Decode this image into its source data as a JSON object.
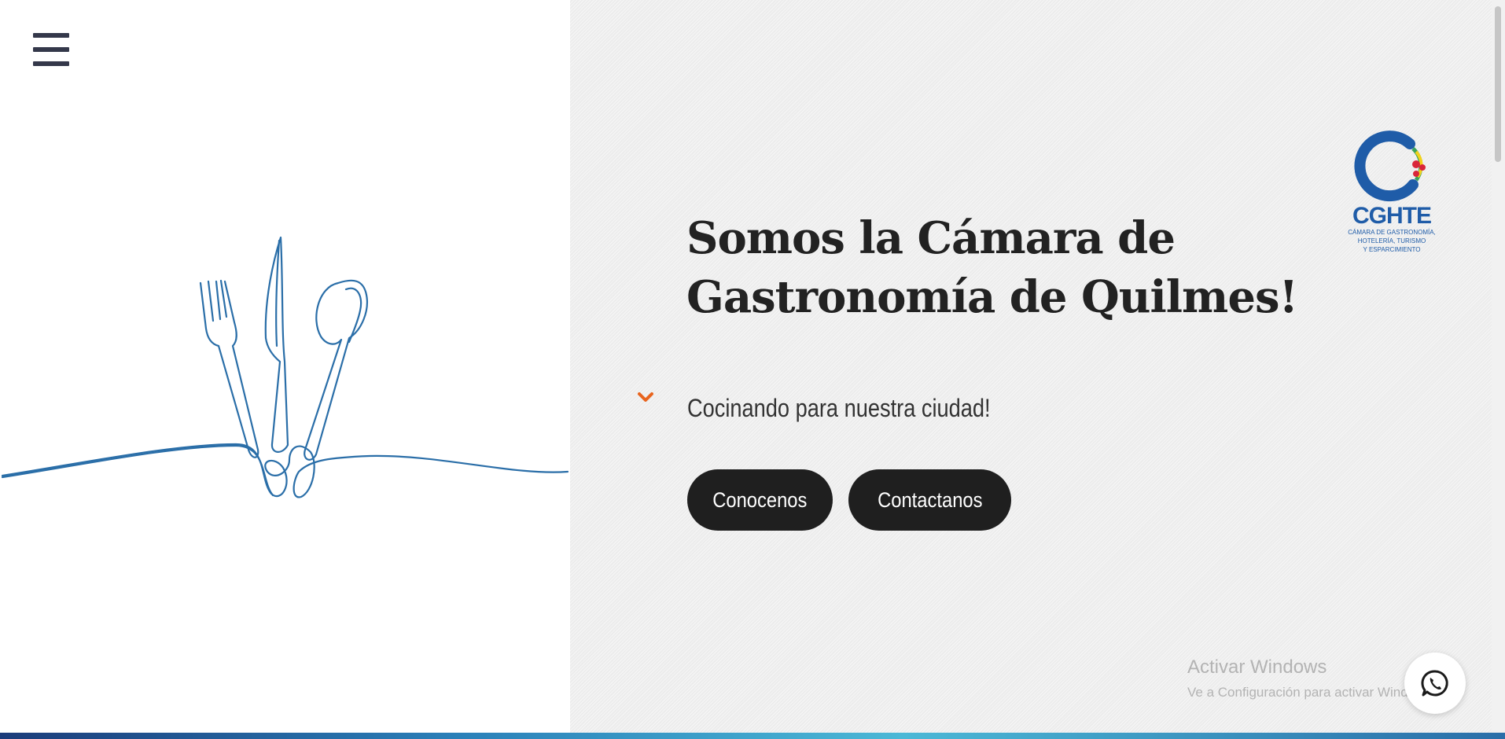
{
  "nav": {
    "menu_icon": "hamburger-menu-icon"
  },
  "hero": {
    "illustration_icon": "fork-knife-spoon-line-art",
    "title": "Somos la Cámara de Gastronomía de Quilmes!",
    "subtitle": "Cocinando para nuestra ciudad!",
    "subtitle_icon": "chevron-down-icon",
    "buttons": {
      "conocenos": "Conocenos",
      "contactanos": "Contactanos"
    }
  },
  "logo": {
    "acronym": "CGHTE",
    "line1": "CÁMARA DE GASTRONOMÍA,",
    "line2": "HOTELERÍA, TURISMO",
    "line3": "Y ESPARCIMIENTO"
  },
  "watermark": {
    "title": "Activar Windows",
    "subtitle": "Ve a Configuración para activar Windows."
  },
  "whatsapp": {
    "icon": "whatsapp-icon"
  },
  "colors": {
    "accent_orange": "#e8641e",
    "button_dark": "#1f1f1f",
    "line_art_blue": "#2a6ea8",
    "logo_blue": "#1f5ca8",
    "logo_green": "#3aa35a",
    "logo_yellow": "#f2d21b",
    "logo_red": "#d9263a",
    "whatsapp_green": "#25a244"
  }
}
